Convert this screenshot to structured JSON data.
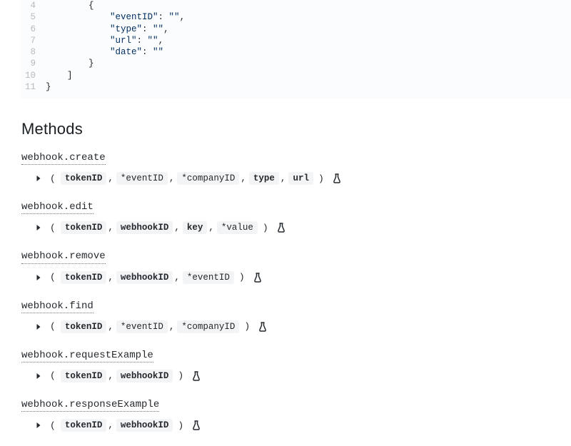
{
  "code": {
    "lines": [
      {
        "n": "4",
        "indent": "        ",
        "text": "{"
      },
      {
        "n": "5",
        "indent": "            ",
        "key": "\"eventID\"",
        "val": "\"\"",
        "tail": ","
      },
      {
        "n": "6",
        "indent": "            ",
        "key": "\"type\"",
        "val": "\"\"",
        "tail": ","
      },
      {
        "n": "7",
        "indent": "            ",
        "key": "\"url\"",
        "val": "\"\"",
        "tail": ","
      },
      {
        "n": "8",
        "indent": "            ",
        "key": "\"date\"",
        "val": "\"\"",
        "tail": ""
      },
      {
        "n": "9",
        "indent": "        ",
        "text": "}"
      },
      {
        "n": "10",
        "indent": "    ",
        "text": "]"
      },
      {
        "n": "11",
        "indent": "",
        "text": "}"
      }
    ]
  },
  "heading": "Methods",
  "methods": [
    {
      "name": "webhook.create",
      "params": [
        {
          "label": "tokenID",
          "required": true
        },
        {
          "label": "*eventID",
          "required": false
        },
        {
          "label": "*companyID",
          "required": false
        },
        {
          "label": "type",
          "required": true
        },
        {
          "label": "url",
          "required": true
        }
      ]
    },
    {
      "name": "webhook.edit",
      "params": [
        {
          "label": "tokenID",
          "required": true
        },
        {
          "label": "webhookID",
          "required": true
        },
        {
          "label": "key",
          "required": true
        },
        {
          "label": "*value",
          "required": false
        }
      ]
    },
    {
      "name": "webhook.remove",
      "params": [
        {
          "label": "tokenID",
          "required": true
        },
        {
          "label": "webhookID",
          "required": true
        },
        {
          "label": "*eventID",
          "required": false
        }
      ]
    },
    {
      "name": "webhook.find",
      "params": [
        {
          "label": "tokenID",
          "required": true
        },
        {
          "label": "*eventID",
          "required": false
        },
        {
          "label": "*companyID",
          "required": false
        }
      ]
    },
    {
      "name": "webhook.requestExample",
      "params": [
        {
          "label": "tokenID",
          "required": true
        },
        {
          "label": "webhookID",
          "required": true
        }
      ]
    },
    {
      "name": "webhook.responseExample",
      "params": [
        {
          "label": "tokenID",
          "required": true
        },
        {
          "label": "webhookID",
          "required": true
        }
      ]
    }
  ]
}
